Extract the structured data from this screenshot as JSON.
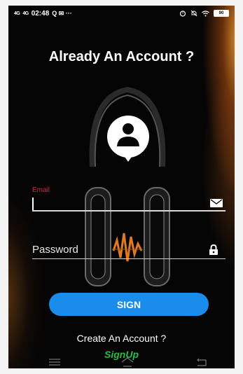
{
  "status_bar": {
    "signal_1": "4G",
    "signal_2": "4G",
    "time": "02:48",
    "notification_glyphs": "Q ✉ ···",
    "right_icons": [
      "alarm-icon",
      "mute-icon",
      "wifi-icon"
    ],
    "battery": "90"
  },
  "title": "Already An Account ?",
  "email": {
    "label": "Email",
    "value": "",
    "icon": "mail-icon"
  },
  "password": {
    "placeholder": "Password",
    "value": "",
    "icon": "lock-icon"
  },
  "sign_button": {
    "label": "SIGN",
    "color": "#1a8cec"
  },
  "create_account_text": "Create An Account ?",
  "signup_link": {
    "label": "SignUp",
    "color": "#2dbb4a"
  },
  "nav": [
    "menu-icon",
    "home-icon",
    "back-icon"
  ],
  "colors": {
    "background": "#050505",
    "email_label": "#d8264f",
    "accent": "#1a8cec"
  }
}
